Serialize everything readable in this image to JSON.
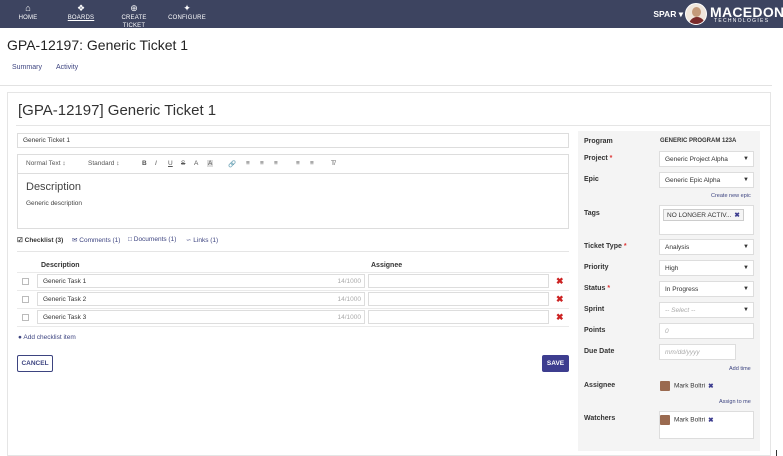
{
  "nav": {
    "items": [
      {
        "label": "HOME",
        "icon": "home-icon"
      },
      {
        "label": "BOARDS",
        "icon": "boards-icon"
      },
      {
        "label": "CREATE TICKET",
        "icon": "plus-circle-icon"
      },
      {
        "label": "CONFIGURE",
        "icon": "wrench-icon"
      }
    ],
    "user": "SPAR",
    "logo_main": "MACEDON",
    "logo_sub": "TECHNOLOGIES"
  },
  "page": {
    "title": "GPA-12197: Generic Ticket 1",
    "subnav": [
      "Summary",
      "Activity"
    ]
  },
  "ticket": {
    "card_title": "[GPA-12197] Generic Ticket 1",
    "title_value": "Generic Ticket 1",
    "editor": {
      "format": "Normal Text",
      "size": "Standard",
      "tools": [
        "B",
        "I",
        "U",
        "S",
        "A",
        "A"
      ],
      "heading": "Description",
      "body": "Generic description"
    }
  },
  "tabs": [
    "Checklist (3)",
    "Comments (1)",
    "Documents (1)",
    "Links (1)"
  ],
  "checklist": {
    "col_description": "Description",
    "col_assignee": "Assignee",
    "items": [
      {
        "text": "Generic Task 1",
        "count": "14/1000"
      },
      {
        "text": "Generic Task 2",
        "count": "14/1000"
      },
      {
        "text": "Generic Task 3",
        "count": "14/1000"
      }
    ],
    "add_label": "Add checklist item",
    "cancel": "CANCEL",
    "save": "SAVE"
  },
  "details": {
    "program_label": "Program",
    "program_value": "GENERIC PROGRAM 123A",
    "project_label": "Project",
    "project_value": "Generic Project Alpha",
    "epic_label": "Epic",
    "epic_value": "Generic Epic Alpha",
    "create_epic": "Create new epic",
    "tags_label": "Tags",
    "tag_value": "NO LONGER ACTIV...",
    "type_label": "Ticket Type",
    "type_value": "Analysis",
    "priority_label": "Priority",
    "priority_value": "High",
    "status_label": "Status",
    "status_value": "In Progress",
    "sprint_label": "Sprint",
    "sprint_value": "-- Select --",
    "points_label": "Points",
    "points_value": "0",
    "due_label": "Due Date",
    "due_value": "mm/dd/yyyy",
    "add_time": "Add time",
    "assignee_label": "Assignee",
    "assignee_value": "Mark Boltri",
    "assign_me": "Assign to me",
    "watchers_label": "Watchers",
    "watcher_value": "Mark Boltri"
  },
  "colors": {
    "nav_bg": "#3d4460",
    "accent": "#3d3d8f",
    "delete": "#cc2222"
  }
}
